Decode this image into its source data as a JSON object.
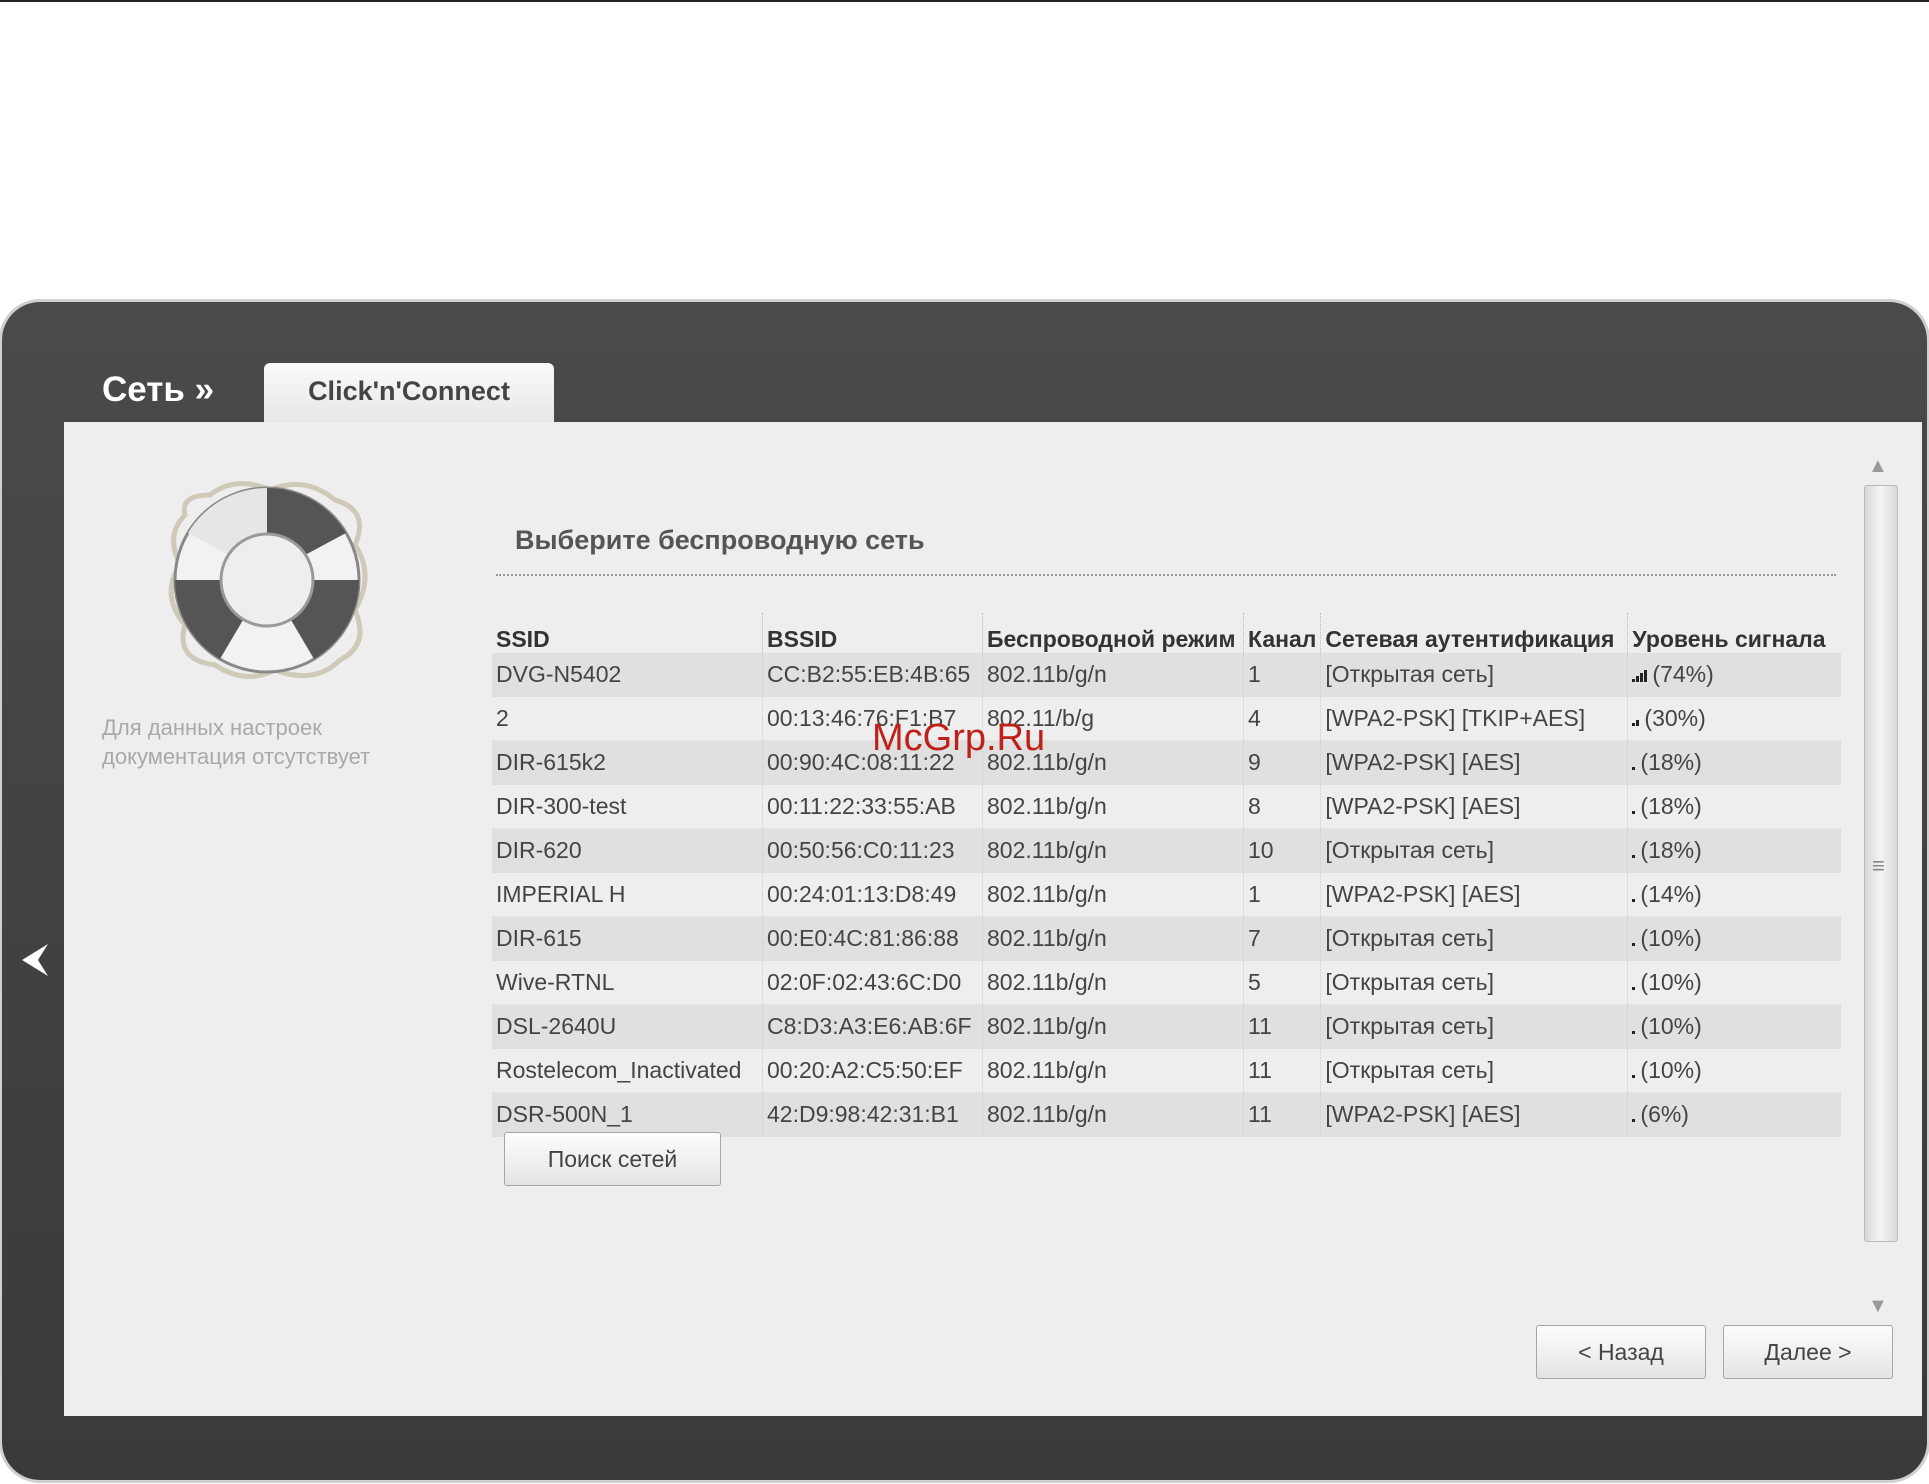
{
  "breadcrumb": {
    "section": "Сеть »",
    "tab": "Click'n'Connect"
  },
  "sidebar": {
    "note": "Для данных настроек документация отсутствует"
  },
  "main": {
    "heading": "Выберите беспроводную сеть",
    "columns": [
      "SSID",
      "BSSID",
      "Беспроводной режим",
      "Канал",
      "Сетевая аутентификация",
      "Уровень сигнала"
    ],
    "networks": [
      {
        "ssid": "DVG-N5402",
        "bssid": "CC:B2:55:EB:4B:65",
        "mode": "802.11b/g/n",
        "channel": "1",
        "auth": "[Открытая сеть]",
        "signal": "(74%)",
        "signal_level": 0.74
      },
      {
        "ssid": "2",
        "bssid": "00:13:46:76:F1:B7",
        "mode": "802.11/b/g",
        "channel": "4",
        "auth": "[WPA2-PSK] [TKIP+AES]",
        "signal": "(30%)",
        "signal_level": 0.3
      },
      {
        "ssid": "DIR-615k2",
        "bssid": "00:90:4C:08:11:22",
        "mode": "802.11b/g/n",
        "channel": "9",
        "auth": "[WPA2-PSK] [AES]",
        "signal": "(18%)",
        "signal_level": 0.18
      },
      {
        "ssid": "DIR-300-test",
        "bssid": "00:11:22:33:55:AB",
        "mode": "802.11b/g/n",
        "channel": "8",
        "auth": "[WPA2-PSK] [AES]",
        "signal": "(18%)",
        "signal_level": 0.18
      },
      {
        "ssid": "DIR-620",
        "bssid": "00:50:56:C0:11:23",
        "mode": "802.11b/g/n",
        "channel": "10",
        "auth": "[Открытая сеть]",
        "signal": "(18%)",
        "signal_level": 0.18
      },
      {
        "ssid": "IMPERIAL H",
        "bssid": "00:24:01:13:D8:49",
        "mode": "802.11b/g/n",
        "channel": "1",
        "auth": "[WPA2-PSK] [AES]",
        "signal": "(14%)",
        "signal_level": 0.14
      },
      {
        "ssid": "DIR-615",
        "bssid": "00:E0:4C:81:86:88",
        "mode": "802.11b/g/n",
        "channel": "7",
        "auth": "[Открытая сеть]",
        "signal": "(10%)",
        "signal_level": 0.1
      },
      {
        "ssid": "Wive-RTNL",
        "bssid": "02:0F:02:43:6C:D0",
        "mode": "802.11b/g/n",
        "channel": "5",
        "auth": "[Открытая сеть]",
        "signal": "(10%)",
        "signal_level": 0.1
      },
      {
        "ssid": "DSL-2640U",
        "bssid": "C8:D3:A3:E6:AB:6F",
        "mode": "802.11b/g/n",
        "channel": "11",
        "auth": "[Открытая сеть]",
        "signal": "(10%)",
        "signal_level": 0.1
      },
      {
        "ssid": "Rostelecom_Inactivated",
        "bssid": "00:20:A2:C5:50:EF",
        "mode": "802.11b/g/n",
        "channel": "11",
        "auth": "[Открытая сеть]",
        "signal": "(10%)",
        "signal_level": 0.1
      },
      {
        "ssid": "DSR-500N_1",
        "bssid": "42:D9:98:42:31:B1",
        "mode": "802.11b/g/n",
        "channel": "11",
        "auth": "[WPA2-PSK] [AES]",
        "signal": "(6%)",
        "signal_level": 0.06
      }
    ],
    "search_button": "Поиск сетей"
  },
  "footer": {
    "back_button": "< Назад",
    "next_button": "Далее >"
  },
  "watermark": "McGrp.Ru",
  "icons": {
    "left_nav": "chevron-left-icon",
    "sidebar": "lifebuoy-icon"
  },
  "colors": {
    "frame": "#3f3f3f",
    "panel": "#eeeeee",
    "watermark": "#c0201a"
  }
}
